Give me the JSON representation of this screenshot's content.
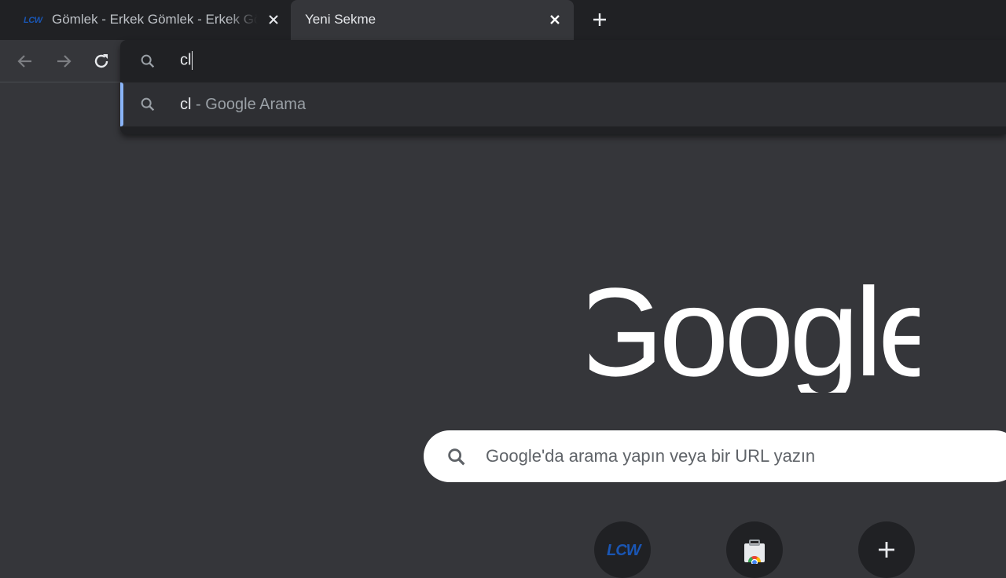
{
  "tabs": [
    {
      "favicon_text": "LCW",
      "title": "Gömlek - Erkek Gömlek - Erkek Gömlek Modelleri",
      "active": false
    },
    {
      "title": "Yeni Sekme",
      "active": true
    }
  ],
  "omnibox": {
    "typed_text": "cl",
    "suggestion": {
      "query": "cl",
      "separator": " - ",
      "description": "Google Arama"
    }
  },
  "google_logo_text": "Google",
  "search": {
    "placeholder": "Google'da arama yapın veya bir URL yazın"
  },
  "shortcuts": [
    {
      "label_icon": "LCW"
    },
    {
      "icon": "chrome-web-store-icon"
    },
    {
      "icon": "add-shortcut-icon"
    }
  ],
  "colors": {
    "accent": "#8ab4f8",
    "dark_bg": "#35363a",
    "tabstrip": "#202124",
    "lcw_blue": "#1a56b4"
  }
}
